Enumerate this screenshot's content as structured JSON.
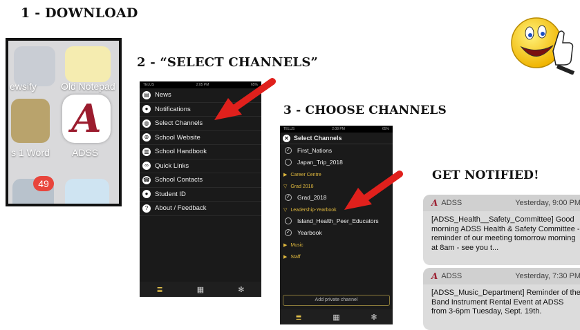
{
  "headings": {
    "step1": "1 - DOWNLOAD",
    "step2": "2 - “SELECT CHANNELS”",
    "step3": "3 - CHOOSE CHANNELS",
    "step4": "GET NOTIFIED!"
  },
  "home_screen": {
    "labels": [
      "ewsify",
      "Old Notepad",
      "s 1 Word",
      "ADSS"
    ],
    "adss_letter": "A",
    "badge": "49"
  },
  "phone2": {
    "status": {
      "carrier": "TELUS",
      "time": "2:05 PM",
      "battery": "65%"
    },
    "menu": [
      {
        "label": "News",
        "icon": "news-icon"
      },
      {
        "label": "Notifications",
        "icon": "chat-icon"
      },
      {
        "label": "Select Channels",
        "icon": "globe-icon"
      },
      {
        "label": "School Website",
        "icon": "web-icon"
      },
      {
        "label": "School Handbook",
        "icon": "book-icon"
      },
      {
        "label": "Quick Links",
        "icon": "link-icon"
      },
      {
        "label": "School Contacts",
        "icon": "phone-icon"
      },
      {
        "label": "Student ID",
        "icon": "person-icon"
      },
      {
        "label": "About / Feedback",
        "icon": "question-icon"
      }
    ]
  },
  "phone3": {
    "status": {
      "carrier": "TELUS",
      "time": "2:08 PM",
      "battery": "65%"
    },
    "title": "Select Channels",
    "channels_top": [
      {
        "name": "First_Nations",
        "checked": true
      },
      {
        "name": "Japan_Trip_2018",
        "checked": false
      }
    ],
    "groups": [
      {
        "name": "Career Centre",
        "expanded": false,
        "channels": []
      },
      {
        "name": "Grad 2018",
        "expanded": true,
        "channels": [
          {
            "name": "Grad_2018",
            "checked": true
          }
        ]
      },
      {
        "name": "Leadership-Yearbook",
        "expanded": true,
        "channels": [
          {
            "name": "Island_Health_Peer_Educators",
            "checked": false
          },
          {
            "name": "Yearbook",
            "checked": true
          }
        ]
      },
      {
        "name": "Music",
        "expanded": false,
        "channels": []
      },
      {
        "name": "Staff",
        "expanded": false,
        "channels": []
      }
    ],
    "add_button": "Add private channel"
  },
  "notifications": [
    {
      "app": "ADSS",
      "time": "Yesterday, 9:00 PM",
      "body": "[ADSS_Health__Safety_Committee] Good morning ADSS Health & Safety Committee - reminder of our meeting tomorrow morning at 8am - see you t..."
    },
    {
      "app": "ADSS",
      "time": "Yesterday, 7:30 PM",
      "body": "[ADSS_Music_Department] Reminder of the Band Instrument Rental Event at ADSS from 3-6pm Tuesday, Sept. 19th."
    }
  ],
  "colors": {
    "arrow": "#e0201c",
    "accent": "#e9c54b",
    "brand": "#9b1c2e"
  }
}
